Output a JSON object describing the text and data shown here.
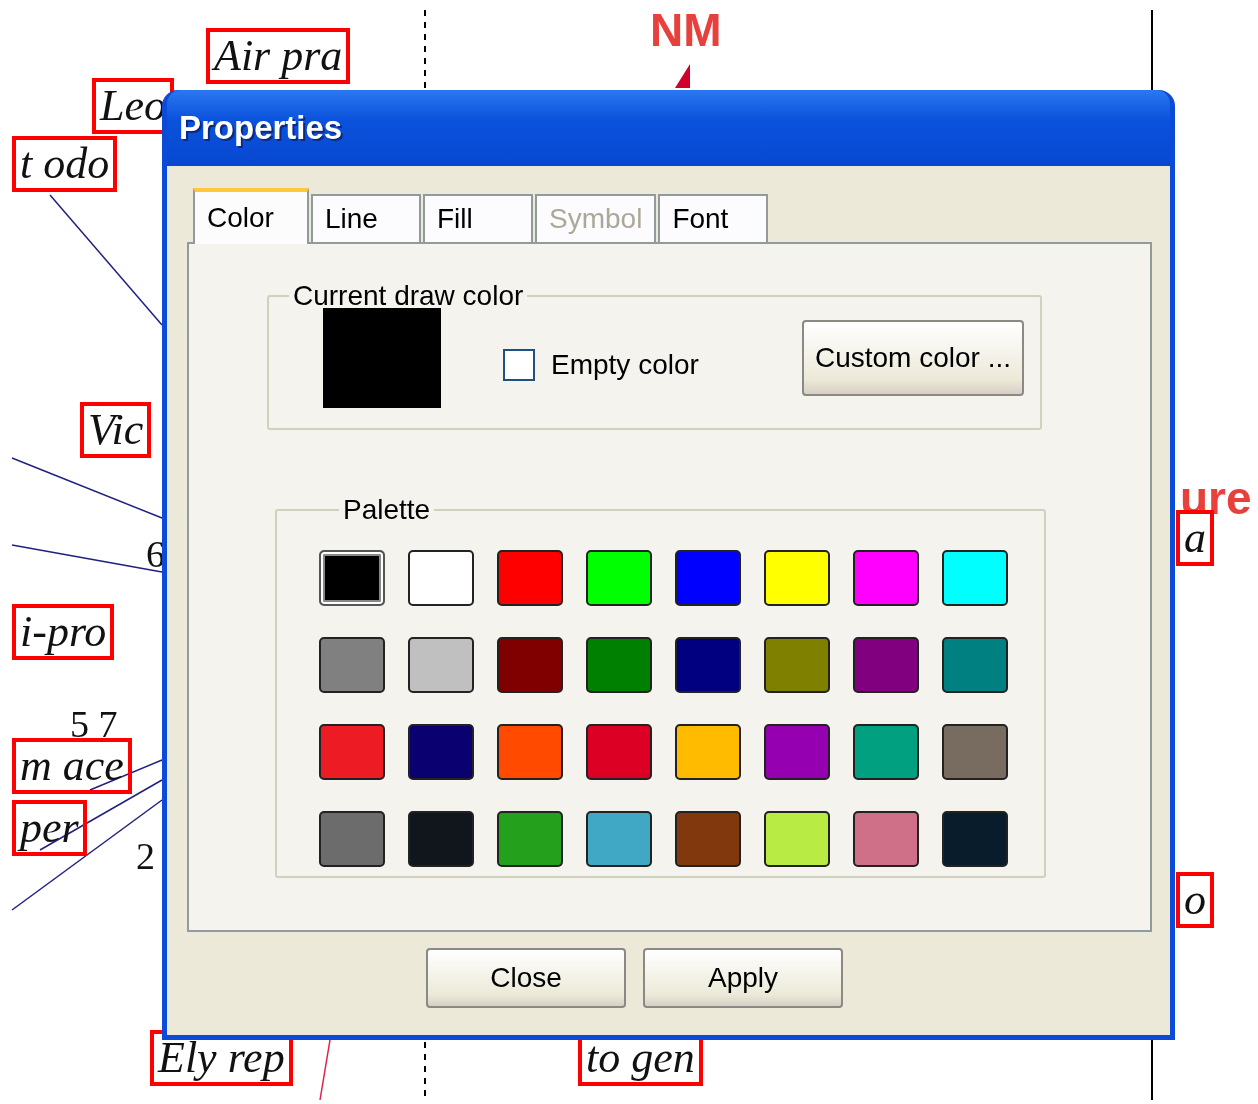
{
  "canvas": {
    "labels": [
      {
        "text": "Air pra",
        "kind": "boxed"
      },
      {
        "text": "Leo",
        "kind": "boxed"
      },
      {
        "text": "t odo",
        "kind": "boxed"
      },
      {
        "text": "Vic",
        "kind": "boxed"
      },
      {
        "text": "6",
        "kind": "plain"
      },
      {
        "text": "i-pro",
        "kind": "boxed"
      },
      {
        "text": "5 7",
        "kind": "plain"
      },
      {
        "text": "m ace",
        "kind": "boxed"
      },
      {
        "text": "per",
        "kind": "boxed"
      },
      {
        "text": "2",
        "kind": "plain"
      },
      {
        "text": "Ely rep",
        "kind": "boxed"
      },
      {
        "text": "to gen",
        "kind": "boxed"
      },
      {
        "text": "NM",
        "kind": "code"
      },
      {
        "text": "ure",
        "kind": "code"
      },
      {
        "text": "a",
        "kind": "boxed"
      },
      {
        "text": "o",
        "kind": "boxed"
      }
    ]
  },
  "dialog": {
    "title": "Properties",
    "tabs": [
      {
        "label": "Color",
        "selected": true,
        "disabled": false
      },
      {
        "label": "Line",
        "selected": false,
        "disabled": false
      },
      {
        "label": "Fill",
        "selected": false,
        "disabled": false
      },
      {
        "label": "Symbol",
        "selected": false,
        "disabled": true
      },
      {
        "label": "Font",
        "selected": false,
        "disabled": false
      }
    ],
    "current": {
      "legend": "Current draw color",
      "color": "#000000",
      "empty_label": "Empty color",
      "empty_checked": false,
      "custom_button": "Custom color ..."
    },
    "palette": {
      "legend": "Palette",
      "swatches": [
        {
          "color": "#000000",
          "selected": true
        },
        {
          "color": "#ffffff",
          "selected": false
        },
        {
          "color": "#ff0000",
          "selected": false
        },
        {
          "color": "#00ff00",
          "selected": false
        },
        {
          "color": "#0000ff",
          "selected": false
        },
        {
          "color": "#ffff00",
          "selected": false
        },
        {
          "color": "#ff00ff",
          "selected": false
        },
        {
          "color": "#00ffff",
          "selected": false
        },
        {
          "color": "#808080",
          "selected": false
        },
        {
          "color": "#c0c0c0",
          "selected": false
        },
        {
          "color": "#800000",
          "selected": false
        },
        {
          "color": "#008000",
          "selected": false
        },
        {
          "color": "#000080",
          "selected": false
        },
        {
          "color": "#808000",
          "selected": false
        },
        {
          "color": "#800080",
          "selected": false
        },
        {
          "color": "#008080",
          "selected": false
        },
        {
          "color": "#ed1c24",
          "selected": false
        },
        {
          "color": "#0a0070",
          "selected": false
        },
        {
          "color": "#ff4a00",
          "selected": false
        },
        {
          "color": "#dc0024",
          "selected": false
        },
        {
          "color": "#ffbb00",
          "selected": false
        },
        {
          "color": "#9500b0",
          "selected": false
        },
        {
          "color": "#00a080",
          "selected": false
        },
        {
          "color": "#786c60",
          "selected": false
        },
        {
          "color": "#6c6c6c",
          "selected": false
        },
        {
          "color": "#10161c",
          "selected": false
        },
        {
          "color": "#24a01c",
          "selected": false
        },
        {
          "color": "#40a8c4",
          "selected": false
        },
        {
          "color": "#80380c",
          "selected": false
        },
        {
          "color": "#b8ec44",
          "selected": false
        },
        {
          "color": "#d07088",
          "selected": false
        },
        {
          "color": "#081c2c",
          "selected": false
        }
      ]
    },
    "buttons": [
      "Close",
      "Apply"
    ]
  }
}
